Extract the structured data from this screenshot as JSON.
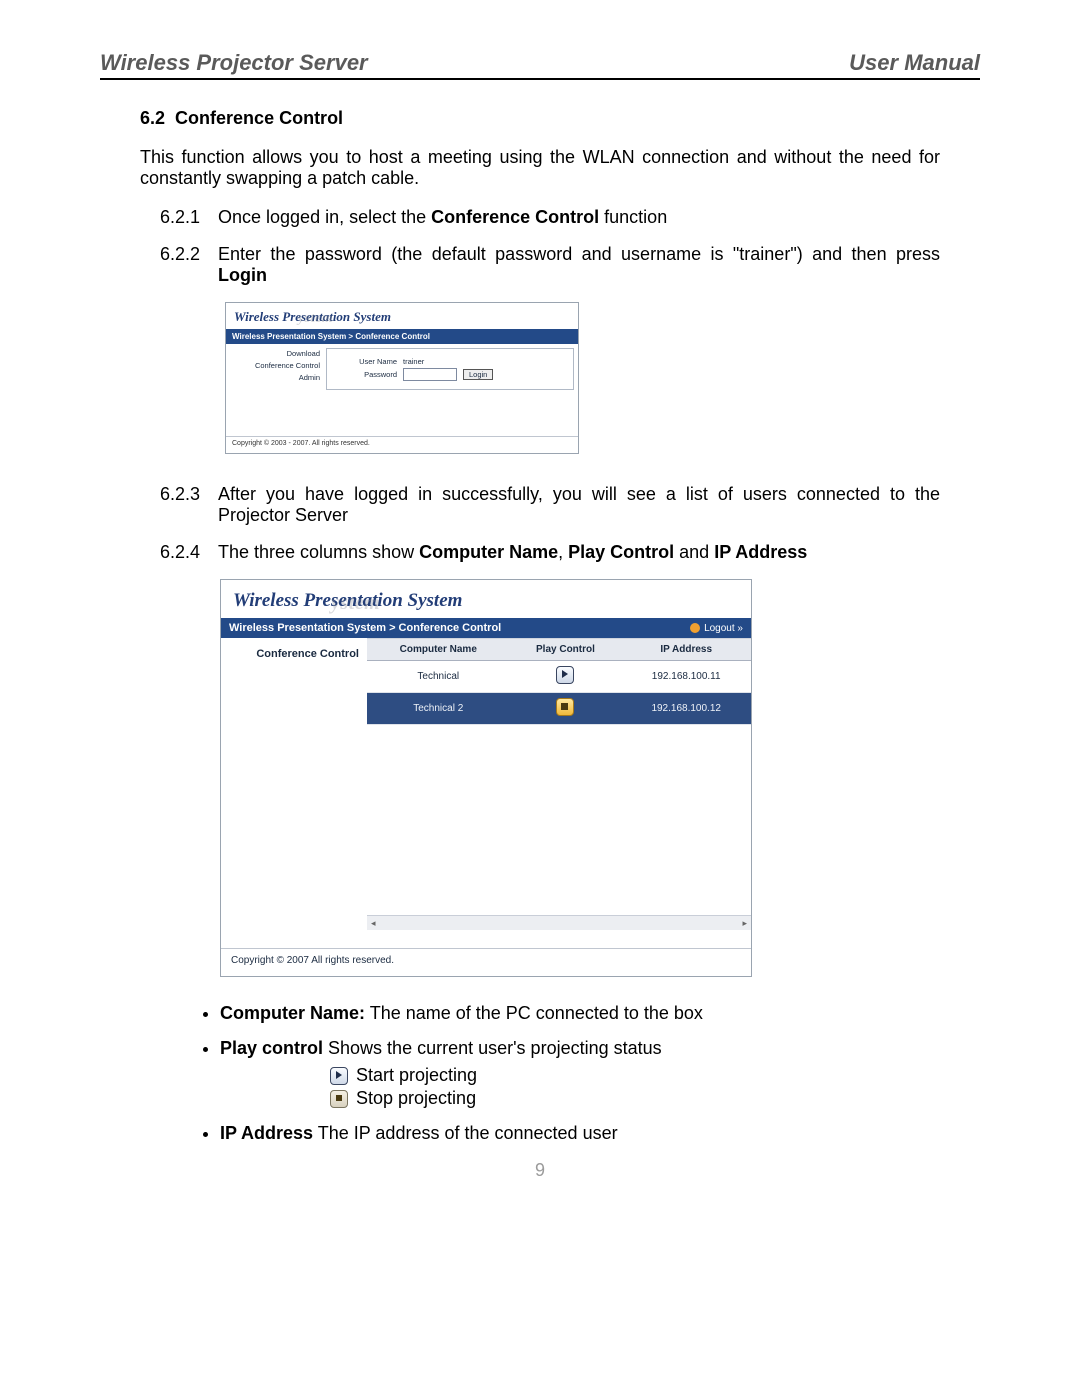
{
  "header": {
    "left": "Wireless Projector Server",
    "right": "User Manual"
  },
  "section": {
    "number": "6.2",
    "title": "Conference Control"
  },
  "intro": "This function allows you to host a meeting using the WLAN connection and without the need for constantly swapping a patch cable.",
  "steps": [
    {
      "num": "6.2.1",
      "pre": "Once logged in, select the ",
      "bold": "Conference Control",
      "post": " function"
    },
    {
      "num": "6.2.2",
      "pre": "Enter the password (the default password and username is \"trainer\") and then press ",
      "bold": "Login",
      "post": ""
    },
    {
      "num": "6.2.3",
      "pre": "After you have logged in successfully, you will see a list of users connected to the Projector Server",
      "bold": "",
      "post": ""
    },
    {
      "num": "6.2.4",
      "pre": "The three columns show ",
      "bold": "Computer Name",
      "mid": ", ",
      "bold2": "Play Control",
      "mid2": " and ",
      "bold3": "IP Address",
      "post": ""
    }
  ],
  "loginShot": {
    "logo": "Wireless Presentation System",
    "ghost": "ystem",
    "breadcrumb": "Wireless Presentation System > Conference Control",
    "nav": [
      "Download",
      "Conference Control",
      "Admin"
    ],
    "userNameLabel": "User Name",
    "userNameValue": "trainer",
    "passwordLabel": "Password",
    "loginButton": "Login",
    "copyright": "Copyright © 2003 - 2007. All rights reserved."
  },
  "confShot": {
    "logo": "Wireless Presentation System",
    "ghost": "ystem",
    "breadcrumb": "Wireless Presentation System > Conference Control",
    "logout": "Logout »",
    "navItem": "Conference Control",
    "columns": [
      "Computer Name",
      "Play Control",
      "IP Address"
    ],
    "rows": [
      {
        "name": "Technical",
        "ip": "192.168.100.11",
        "playing": true,
        "selected": false
      },
      {
        "name": "Technical 2",
        "ip": "192.168.100.12",
        "playing": false,
        "selected": true
      }
    ],
    "copyright": "Copyright © 2007 All rights reserved."
  },
  "bullets": {
    "b1_bold": "Computer Name:",
    "b1_text": " The name of the PC connected to the box",
    "b2_bold": "Play control",
    "b2_text": " Shows the current user's projecting status",
    "b2_sub": [
      "Start projecting",
      "Stop projecting"
    ],
    "b3_bold": "IP Address",
    "b3_text": " The IP address of the connected user"
  },
  "pageNumber": "9"
}
